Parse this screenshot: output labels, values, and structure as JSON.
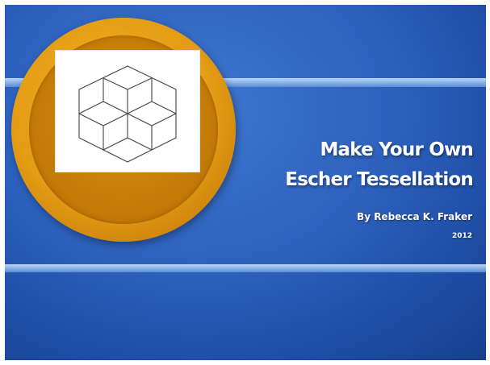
{
  "slide": {
    "title_line_1": "Make Your Own",
    "title_line_2": "Escher Tessellation",
    "author": "By Rebecca K. Fraker",
    "year": "2012"
  },
  "colors": {
    "background_blue": "#2d62bf",
    "stripe_blue": "#8db6ec",
    "circle_orange": "#e39c14",
    "circle_inner_orange": "#c47c08",
    "text": "#ffffff"
  },
  "image": {
    "icon": "tessellation-cube-star-icon"
  }
}
